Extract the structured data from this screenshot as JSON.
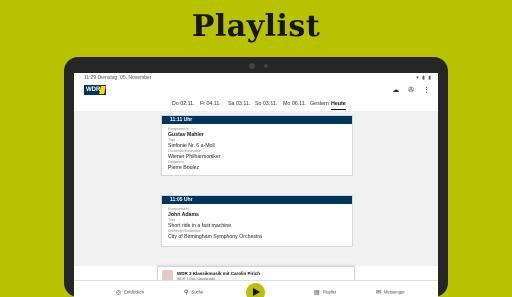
{
  "banner": {
    "title": "Playlist"
  },
  "status": {
    "time": "11:29  Dienstag, 05. November",
    "icons": "▾ ▮ ▮"
  },
  "app": {
    "logo_text": "WDR",
    "header_icons": [
      "☁",
      "✇",
      "⋮"
    ]
  },
  "tabs": [
    {
      "label": "Do 02.11.",
      "active": false
    },
    {
      "label": "Fr 04.11.",
      "active": false
    },
    {
      "label": "Sa 03.11.",
      "active": false
    },
    {
      "label": "So 03.11.",
      "active": false
    },
    {
      "label": "Mo 06.11.",
      "active": false
    },
    {
      "label": "Gestern",
      "active": false
    },
    {
      "label": "Heute",
      "active": true
    }
  ],
  "cards": [
    {
      "time": "11:11 Uhr",
      "fields": [
        {
          "label": "Komponist:in",
          "value": "Gustav Mahler",
          "bold": true
        },
        {
          "label": "Titel",
          "value": "Sinfonie Nr. 6 a-Moll",
          "bold": false
        },
        {
          "label": "Orchester/Ensemble",
          "value": "Wiener Philharmoniker",
          "bold": false
        },
        {
          "label": "Dirigent:in",
          "value": "Pierre Boulez",
          "bold": false
        }
      ]
    },
    {
      "time": "11:05 Uhr",
      "fields": [
        {
          "label": "Komponist:in",
          "value": "John Adams",
          "bold": true
        },
        {
          "label": "Titel",
          "value": "Short ride in a fast machine",
          "bold": false
        },
        {
          "label": "Orchester/Ensemble",
          "value": "City of Birmingham Symphony Orchestra",
          "bold": false
        }
      ]
    }
  ],
  "miniplayer": {
    "title": "WDR 3 Klassikmusik mit Carolin Pirich",
    "subtitle": "WDR 3 Das Klassikradio"
  },
  "nav": {
    "items": [
      {
        "label": "Entdecken",
        "icon": "◎"
      },
      {
        "label": "Suche",
        "icon": "⚲"
      },
      {
        "label": "Playlist",
        "icon": "▤"
      },
      {
        "label": "Messenger",
        "icon": "✉"
      }
    ]
  }
}
